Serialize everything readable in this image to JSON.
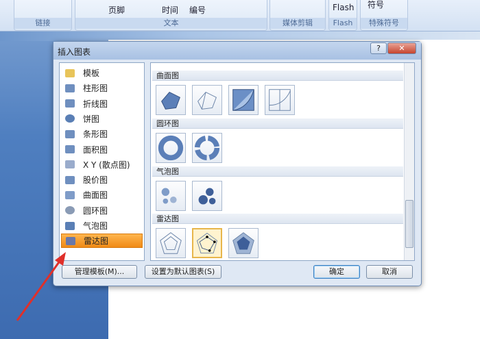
{
  "ribbon": {
    "top_texts": {
      "footer": "页脚",
      "time": "时间",
      "number": "编号",
      "flash": "Flash",
      "symbol": "符号"
    },
    "groups": [
      "链接",
      "文本",
      "媒体剪辑",
      "Flash",
      "特殊符号"
    ]
  },
  "dialog": {
    "title": "插入图表",
    "help": "?",
    "close": "✕",
    "categories": [
      "模板",
      "柱形图",
      "折线图",
      "饼图",
      "条形图",
      "面积图",
      "X Y (散点图)",
      "股价图",
      "曲面图",
      "圆环图",
      "气泡图",
      "雷达图"
    ],
    "selected_category": "雷达图",
    "sections": [
      "曲面图",
      "圆环图",
      "气泡图",
      "雷达图"
    ],
    "buttons": {
      "manage": "管理模板(M)...",
      "set_default": "设置为默认图表(S)",
      "ok": "确定",
      "cancel": "取消"
    }
  },
  "colors": {
    "selection": "#f08a16",
    "accent": "#5a7fb5"
  }
}
